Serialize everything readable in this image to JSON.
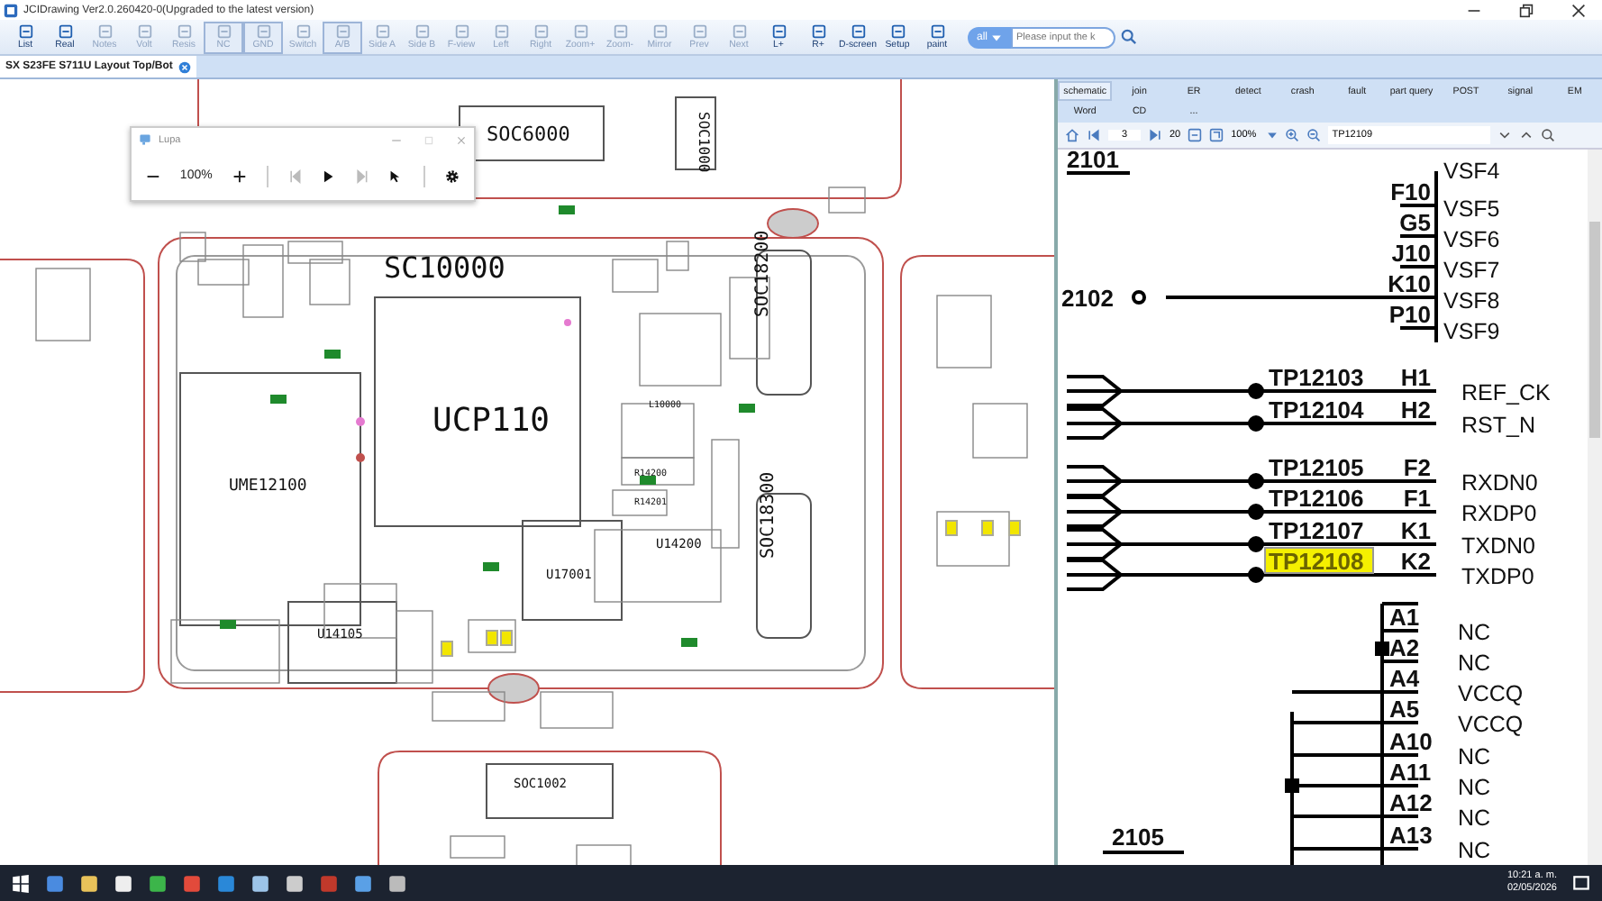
{
  "window": {
    "title": "JCIDrawing Ver2.0.260420-0(Upgraded to the latest version)"
  },
  "toolbar": [
    {
      "label": "List",
      "selected": false,
      "disabled": false
    },
    {
      "label": "Real",
      "selected": false,
      "disabled": false
    },
    {
      "label": "Notes",
      "selected": false,
      "disabled": true
    },
    {
      "label": "Volt",
      "selected": false,
      "disabled": true
    },
    {
      "label": "Resis",
      "selected": false,
      "disabled": true
    },
    {
      "label": "NC",
      "selected": true,
      "disabled": true
    },
    {
      "label": "GND",
      "selected": true,
      "disabled": true
    },
    {
      "label": "Switch",
      "selected": false,
      "disabled": true
    },
    {
      "label": "A/B",
      "selected": true,
      "disabled": true
    },
    {
      "label": "Side A",
      "selected": false,
      "disabled": true
    },
    {
      "label": "Side B",
      "selected": false,
      "disabled": true
    },
    {
      "label": "F-view",
      "selected": false,
      "disabled": true
    },
    {
      "label": "Left",
      "selected": false,
      "disabled": true
    },
    {
      "label": "Right",
      "selected": false,
      "disabled": true
    },
    {
      "label": "Zoom+",
      "selected": false,
      "disabled": true
    },
    {
      "label": "Zoom-",
      "selected": false,
      "disabled": true
    },
    {
      "label": "Mirror",
      "selected": false,
      "disabled": true
    },
    {
      "label": "Prev",
      "selected": false,
      "disabled": true
    },
    {
      "label": "Next",
      "selected": false,
      "disabled": true
    },
    {
      "label": "L+",
      "selected": false,
      "disabled": false
    },
    {
      "label": "R+",
      "selected": false,
      "disabled": false
    },
    {
      "label": "D-screen",
      "selected": false,
      "disabled": false
    },
    {
      "label": "Setup",
      "selected": false,
      "disabled": false
    },
    {
      "label": "paint",
      "selected": false,
      "disabled": false
    }
  ],
  "search": {
    "scope": "all",
    "placeholder": "Please input the k"
  },
  "document_tabs": [
    {
      "label": "SX S23FE S711U Layout Top/Bot",
      "selected": true
    }
  ],
  "layout": {
    "labels": [
      "SOC6000",
      "SOC1000",
      "SC10000",
      "UCP110",
      "UME12100",
      "SOC18200",
      "SOC18300",
      "U17001",
      "U14105",
      "U14200",
      "L10000",
      "R14200",
      "R14201",
      "SOC1002"
    ]
  },
  "lupa": {
    "title": "Lupa",
    "zoom": "100%"
  },
  "panel": {
    "tabs": [
      {
        "label": "schematic",
        "selected": true
      },
      {
        "label": "join",
        "selected": false
      },
      {
        "label": "ER",
        "selected": false
      },
      {
        "label": "detect",
        "selected": false
      },
      {
        "label": "crash",
        "selected": false
      },
      {
        "label": "fault",
        "selected": false
      },
      {
        "label": "part query",
        "selected": false
      },
      {
        "label": "POST",
        "selected": false
      },
      {
        "label": "signal",
        "selected": false
      },
      {
        "label": "EM",
        "selected": false
      },
      {
        "label": "Word",
        "selected": false
      },
      {
        "label": "CD",
        "selected": false
      },
      {
        "label": "...",
        "selected": false
      }
    ],
    "page": "3",
    "pages": "20",
    "zoom": "100%",
    "search": "TP12109"
  },
  "schematic": {
    "top_net": "2101",
    "net_2102": "2102",
    "bottom_net": "2105",
    "top_label": "VSF4",
    "upper_pins": [
      {
        "pin": "F10",
        "net": "VSF5"
      },
      {
        "pin": "G5",
        "net": "VSF6"
      },
      {
        "pin": "J10",
        "net": "VSF7"
      },
      {
        "pin": "K10",
        "net": "VSF8"
      },
      {
        "pin": "P10",
        "net": "VSF9"
      }
    ],
    "test_points": [
      {
        "tp": "TP12103",
        "pin": "H1",
        "net": "REF_CK",
        "highlighted": false
      },
      {
        "tp": "TP12104",
        "pin": "H2",
        "net": "RST_N",
        "highlighted": false
      },
      {
        "tp": "TP12105",
        "pin": "F2",
        "net": "RXDN0",
        "highlighted": false
      },
      {
        "tp": "TP12106",
        "pin": "F1",
        "net": "RXDP0",
        "highlighted": false
      },
      {
        "tp": "TP12107",
        "pin": "K1",
        "net": "TXDN0",
        "highlighted": false
      },
      {
        "tp": "TP12108",
        "pin": "K2",
        "net": "TXDP0",
        "highlighted": true
      }
    ],
    "lower_pins": [
      {
        "pin": "A1",
        "net": "NC"
      },
      {
        "pin": "A2",
        "net": "NC"
      },
      {
        "pin": "A4",
        "net": "VCCQ"
      },
      {
        "pin": "A5",
        "net": "VCCQ"
      },
      {
        "pin": "A10",
        "net": "NC"
      },
      {
        "pin": "A11",
        "net": "NC"
      },
      {
        "pin": "A12",
        "net": "NC"
      },
      {
        "pin": "A13",
        "net": "NC"
      }
    ]
  },
  "taskbar": {
    "time": "10:21 a. m.",
    "date": "02/05/2026"
  }
}
